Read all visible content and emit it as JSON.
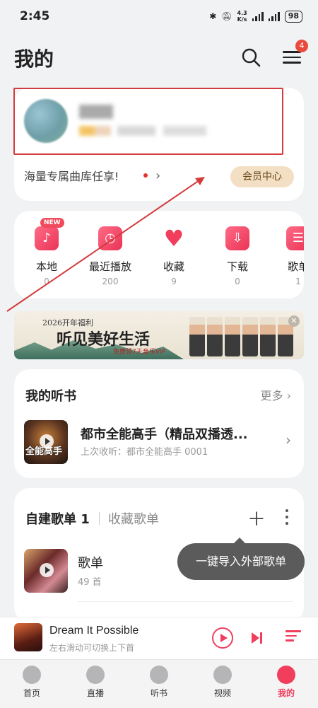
{
  "status_bar": {
    "time": "2:45",
    "net_speed": "4.3",
    "net_unit": "K/s",
    "battery": "98"
  },
  "header": {
    "title": "我的",
    "badge_count": "4",
    "search_icon": "search-icon",
    "menu_icon": "menu-icon"
  },
  "profile": {
    "promo_text": "海量专属曲库任享!",
    "vip_button": "会员中心"
  },
  "quick_access": [
    {
      "label": "本地",
      "count": "0",
      "icon": "music-note-icon",
      "badge": "NEW"
    },
    {
      "label": "最近播放",
      "count": "200",
      "icon": "clock-icon"
    },
    {
      "label": "收藏",
      "count": "9",
      "icon": "heart-icon"
    },
    {
      "label": "下载",
      "count": "0",
      "icon": "download-icon"
    },
    {
      "label": "歌单",
      "count": "1",
      "icon": "playlist-icon"
    }
  ],
  "banner": {
    "year_text": "2026开年福利",
    "slogan": "听见美好生活",
    "sub": "免费领7天音乐VIP"
  },
  "audiobooks": {
    "title": "我的听书",
    "more": "更多",
    "item": {
      "title": "都市全能高手（精品双播透...",
      "subtitle": "上次收听：都市全能高手 0001",
      "cover_text": "全能高手"
    }
  },
  "playlists": {
    "tab_created": "自建歌单 1",
    "tab_collected": "收藏歌单",
    "item": {
      "name": "歌单",
      "count": "49 首"
    },
    "tooltip": "一键导入外部歌单"
  },
  "now_playing": {
    "title": "Dream It Possible",
    "subtitle": "左右滑动可切换上下首"
  },
  "tabs": [
    {
      "label": "首页",
      "icon": "home-icon"
    },
    {
      "label": "直播",
      "icon": "live-icon"
    },
    {
      "label": "听书",
      "icon": "podcast-icon"
    },
    {
      "label": "视频",
      "icon": "video-icon"
    },
    {
      "label": "我的",
      "icon": "profile-icon",
      "active": true
    }
  ],
  "colors": {
    "accent": "#f03e5c",
    "background": "#f1f2f4",
    "vip": "#f3dfc3"
  }
}
